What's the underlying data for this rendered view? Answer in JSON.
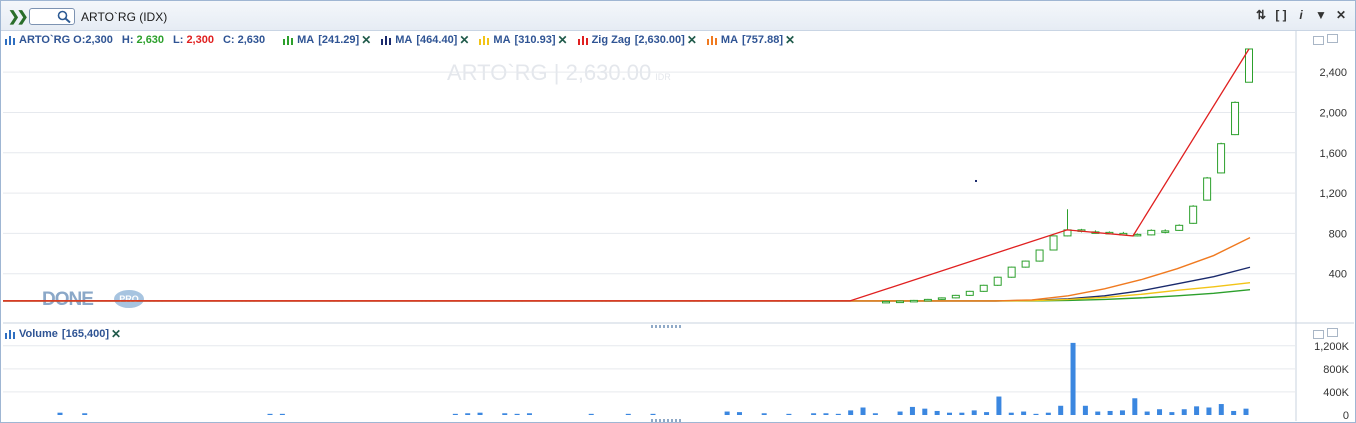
{
  "header": {
    "symbol": "ARTO`RG (IDX)",
    "search_placeholder": ""
  },
  "watermark": {
    "text": "ARTO`RG | 2,630.00",
    "unit": "IDR"
  },
  "logo": {
    "text": "DONE",
    "badge": "PRO"
  },
  "legend": {
    "symbol": "ARTO`RG",
    "open_label": "O:",
    "open": "2,300",
    "high_label": "H:",
    "high": "2,630",
    "low_label": "L:",
    "low": "2,300",
    "close_label": "C:",
    "close": "2,630",
    "indicators": [
      {
        "label": "MA",
        "value": "[241.29]",
        "color": "#2ca02c"
      },
      {
        "label": "MA",
        "value": "[464.40]",
        "color": "#1a2a6c"
      },
      {
        "label": "MA",
        "value": "[310.93]",
        "color": "#f2c418"
      },
      {
        "label": "Zig Zag",
        "value": "[2,630.00]",
        "color": "#e02020"
      },
      {
        "label": "MA",
        "value": "[757.88]",
        "color": "#f07a20"
      }
    ],
    "volume_label": "Volume",
    "volume_value": "[165,400]"
  },
  "colors": {
    "up": "#2ca02c",
    "volume": "#3b87e0",
    "ohlc_high": "#2ca02c",
    "ohlc_low": "#e02020",
    "ohlc_text": "#2f5494"
  },
  "chart_data": [
    {
      "type": "line",
      "title": "ARTO`RG (IDX)",
      "ylim": [
        0,
        2600
      ],
      "yticks": [
        400,
        800,
        1200,
        1600,
        2000,
        2400
      ],
      "ytick_labels": [
        "400",
        "800",
        "1,200",
        "1,600",
        "2,000",
        "2,400"
      ],
      "grid": true,
      "candles_recent": [
        {
          "o": 120,
          "h": 130,
          "l": 115,
          "c": 125
        },
        {
          "o": 125,
          "h": 135,
          "l": 120,
          "c": 128
        },
        {
          "o": 128,
          "h": 140,
          "l": 125,
          "c": 135
        },
        {
          "o": 135,
          "h": 150,
          "l": 130,
          "c": 145
        },
        {
          "o": 145,
          "h": 165,
          "l": 140,
          "c": 160
        },
        {
          "o": 160,
          "h": 190,
          "l": 155,
          "c": 185
        },
        {
          "o": 185,
          "h": 230,
          "l": 180,
          "c": 225
        },
        {
          "o": 225,
          "h": 290,
          "l": 220,
          "c": 285
        },
        {
          "o": 285,
          "h": 370,
          "l": 280,
          "c": 365
        },
        {
          "o": 365,
          "h": 470,
          "l": 360,
          "c": 465
        },
        {
          "o": 465,
          "h": 530,
          "l": 460,
          "c": 525
        },
        {
          "o": 525,
          "h": 640,
          "l": 520,
          "c": 635
        },
        {
          "o": 635,
          "h": 780,
          "l": 630,
          "c": 775
        },
        {
          "o": 775,
          "h": 1040,
          "l": 770,
          "c": 835
        },
        {
          "o": 835,
          "h": 845,
          "l": 810,
          "c": 825
        },
        {
          "o": 815,
          "h": 830,
          "l": 800,
          "c": 810
        },
        {
          "o": 810,
          "h": 820,
          "l": 790,
          "c": 800
        },
        {
          "o": 800,
          "h": 815,
          "l": 785,
          "c": 795
        },
        {
          "o": 780,
          "h": 800,
          "l": 770,
          "c": 790
        },
        {
          "o": 785,
          "h": 840,
          "l": 780,
          "c": 830
        },
        {
          "o": 820,
          "h": 840,
          "l": 800,
          "c": 825
        },
        {
          "o": 830,
          "h": 890,
          "l": 825,
          "c": 880
        },
        {
          "o": 900,
          "h": 1080,
          "l": 895,
          "c": 1070
        },
        {
          "o": 1130,
          "h": 1360,
          "l": 1125,
          "c": 1350
        },
        {
          "o": 1400,
          "h": 1700,
          "l": 1395,
          "c": 1690
        },
        {
          "o": 1780,
          "h": 2110,
          "l": 1775,
          "c": 2100
        },
        {
          "o": 2300,
          "h": 2630,
          "l": 2300,
          "c": 2630
        }
      ],
      "zigzag": [
        [
          0,
          130
        ],
        [
          0.56,
          130
        ],
        [
          0.78,
          835
        ],
        [
          0.85,
          775
        ],
        [
          1,
          2630
        ]
      ],
      "series": [
        {
          "name": "MA [241.29]",
          "values": [
            130,
            130,
            130,
            130,
            130,
            130,
            135,
            145,
            160,
            180,
            205,
            241
          ]
        },
        {
          "name": "MA [464.40]",
          "values": [
            130,
            130,
            130,
            130,
            130,
            135,
            150,
            180,
            230,
            300,
            370,
            464
          ]
        },
        {
          "name": "MA [310.93]",
          "values": [
            130,
            130,
            130,
            130,
            130,
            132,
            145,
            165,
            195,
            235,
            270,
            311
          ]
        },
        {
          "name": "MA [757.88]",
          "values": [
            130,
            130,
            130,
            130,
            130,
            140,
            180,
            250,
            340,
            450,
            580,
            758
          ]
        }
      ]
    },
    {
      "type": "bar",
      "title": "Volume",
      "ylim": [
        0,
        1300000
      ],
      "yticks": [
        400000,
        800000,
        1200000
      ],
      "ytick_labels": [
        "400K",
        "800K",
        "1,200K"
      ],
      "values": [
        40000,
        0,
        30000,
        0,
        0,
        0,
        0,
        0,
        0,
        0,
        0,
        0,
        0,
        0,
        0,
        0,
        0,
        20000,
        20000,
        0,
        0,
        0,
        0,
        0,
        0,
        0,
        0,
        0,
        0,
        0,
        0,
        0,
        20000,
        30000,
        40000,
        0,
        30000,
        20000,
        30000,
        0,
        0,
        0,
        0,
        20000,
        0,
        0,
        20000,
        0,
        20000,
        0,
        0,
        0,
        0,
        0,
        60000,
        50000,
        0,
        30000,
        0,
        20000,
        0,
        30000,
        30000,
        20000,
        80000,
        130000,
        30000,
        0,
        60000,
        140000,
        110000,
        70000,
        40000,
        40000,
        80000,
        50000,
        320000,
        40000,
        60000,
        20000,
        40000,
        160000,
        1250000,
        160000,
        60000,
        70000,
        80000,
        290000,
        60000,
        100000,
        50000,
        100000,
        150000,
        130000,
        190000,
        70000,
        110000
      ]
    }
  ]
}
